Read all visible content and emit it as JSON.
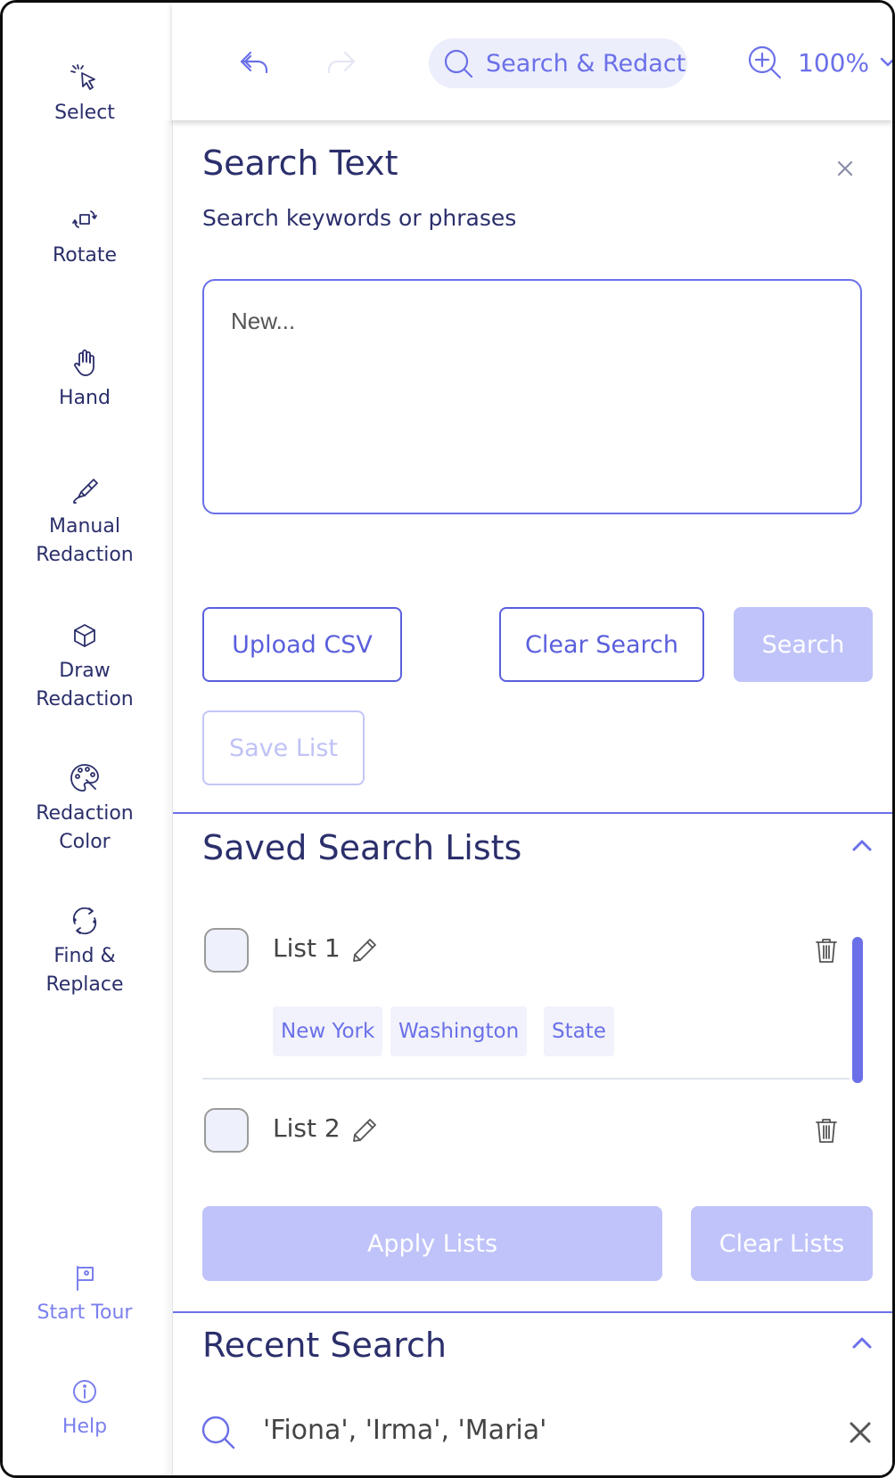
{
  "sidebar": {
    "tools": [
      {
        "icon": "select-cursor-icon",
        "label": "Select"
      },
      {
        "icon": "rotate-icon",
        "label": "Rotate"
      },
      {
        "icon": "hand-icon",
        "label": "Hand"
      },
      {
        "icon": "manual-redaction-icon",
        "label_line1": "Manual",
        "label_line2": "Redaction"
      },
      {
        "icon": "draw-redaction-cube-icon",
        "label_line1": "Draw",
        "label_line2": "Redaction"
      },
      {
        "icon": "palette-icon",
        "label_line1": "Redaction",
        "label_line2": "Color"
      },
      {
        "icon": "find-replace-icon",
        "label_line1": "Find &",
        "label_line2": "Replace"
      }
    ],
    "start_tour": "Start Tour",
    "help": "Help"
  },
  "toolbar": {
    "undo_icon": "undo-icon",
    "redo_icon": "redo-icon",
    "search_redact_label": "Search & Redact",
    "zoom_value": "100%"
  },
  "search_panel": {
    "title": "Search Text",
    "subtitle": "Search keywords or phrases",
    "input_placeholder": "New...",
    "upload_csv": "Upload CSV",
    "clear_search": "Clear Search",
    "search": "Search",
    "save_list": "Save List"
  },
  "saved_lists": {
    "title": "Saved Search Lists",
    "lists": [
      {
        "name": "List 1",
        "tags": [
          "New York",
          "Washington",
          "State"
        ]
      },
      {
        "name": "List 2",
        "tags": []
      }
    ],
    "apply_lists": "Apply Lists",
    "clear_lists": "Clear Lists"
  },
  "recent_search": {
    "title": "Recent Search",
    "items": [
      "'Fiona', 'Irma', 'Maria'"
    ]
  },
  "colors": {
    "accent": "#6b70e8",
    "navy_text": "#2b2f6b",
    "disabled_fill": "#bfc3f9",
    "tag_bg": "#f1f2fb"
  }
}
